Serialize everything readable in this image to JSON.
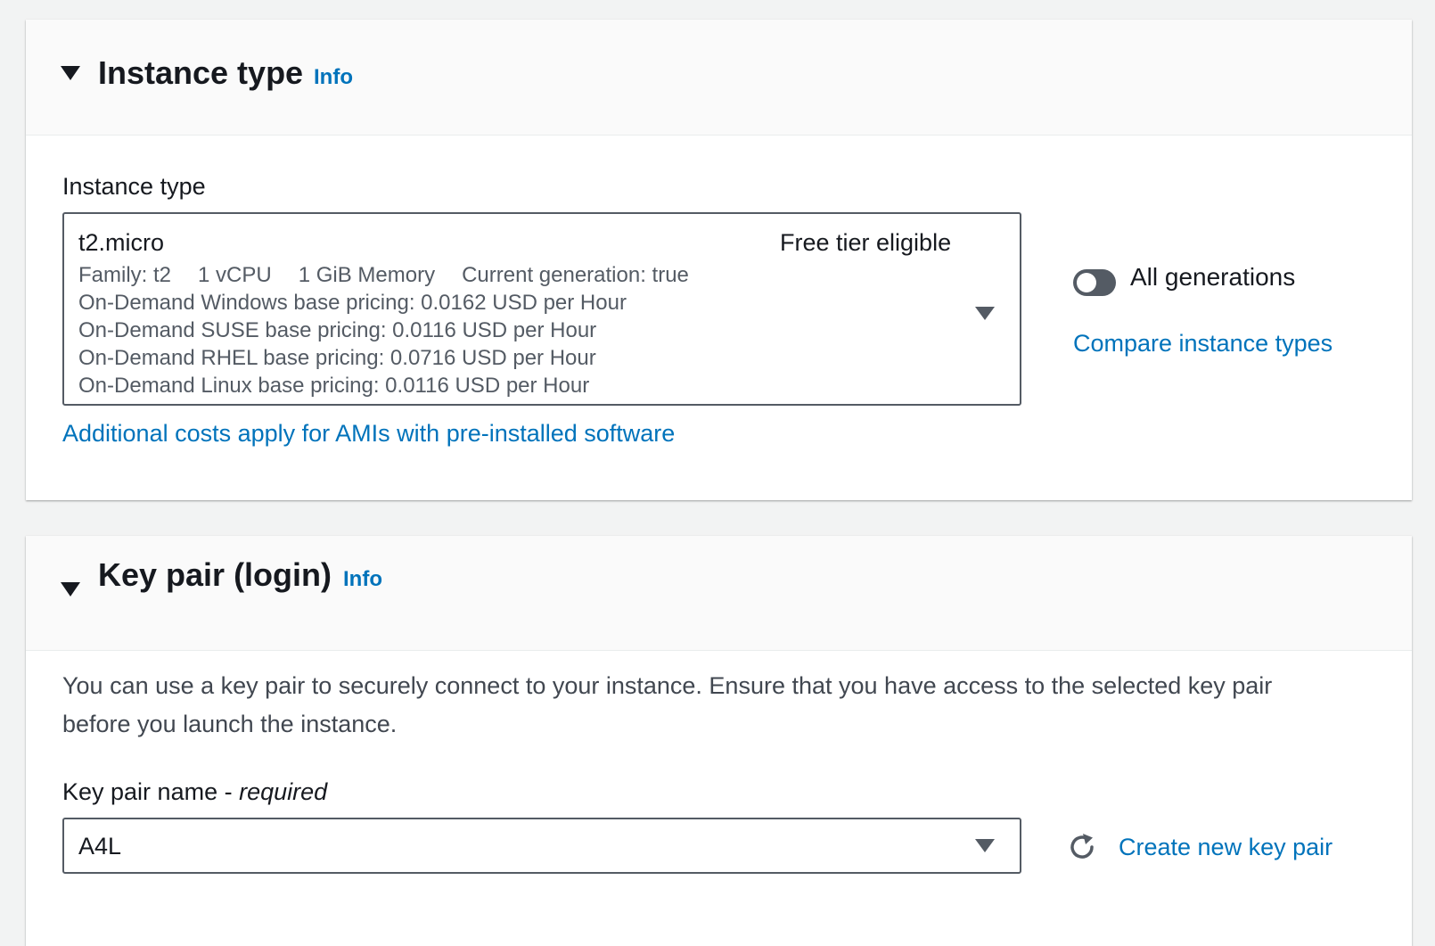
{
  "instance_type_section": {
    "title": "Instance type",
    "info_label": "Info",
    "field_label": "Instance type",
    "selected": {
      "name": "t2.micro",
      "badge": "Free tier eligible",
      "family": "Family: t2",
      "vcpu": "1 vCPU",
      "memory": "1 GiB Memory",
      "generation": "Current generation: true",
      "pricing": [
        "On-Demand Windows base pricing: 0.0162 USD per Hour",
        "On-Demand SUSE base pricing: 0.0116 USD per Hour",
        "On-Demand RHEL base pricing: 0.0716 USD per Hour",
        "On-Demand Linux base pricing: 0.0116 USD per Hour"
      ]
    },
    "additional_costs_link": "Additional costs apply for AMIs with pre-installed software",
    "all_generations_toggle": {
      "label": "All generations",
      "checked": false
    },
    "compare_link": "Compare instance types"
  },
  "key_pair_section": {
    "title": "Key pair (login)",
    "info_label": "Info",
    "description": "You can use a key pair to securely connect to your instance. Ensure that you have access to the selected key pair before you launch the instance.",
    "field_label": "Key pair name - ",
    "field_required": "required",
    "selected_value": "A4L",
    "create_link": "Create new key pair"
  },
  "colors": {
    "link": "#0073bb",
    "text": "#16191f",
    "secondary_text": "#545b64",
    "background": "#f2f3f3",
    "toggle_off": "#545b64"
  }
}
